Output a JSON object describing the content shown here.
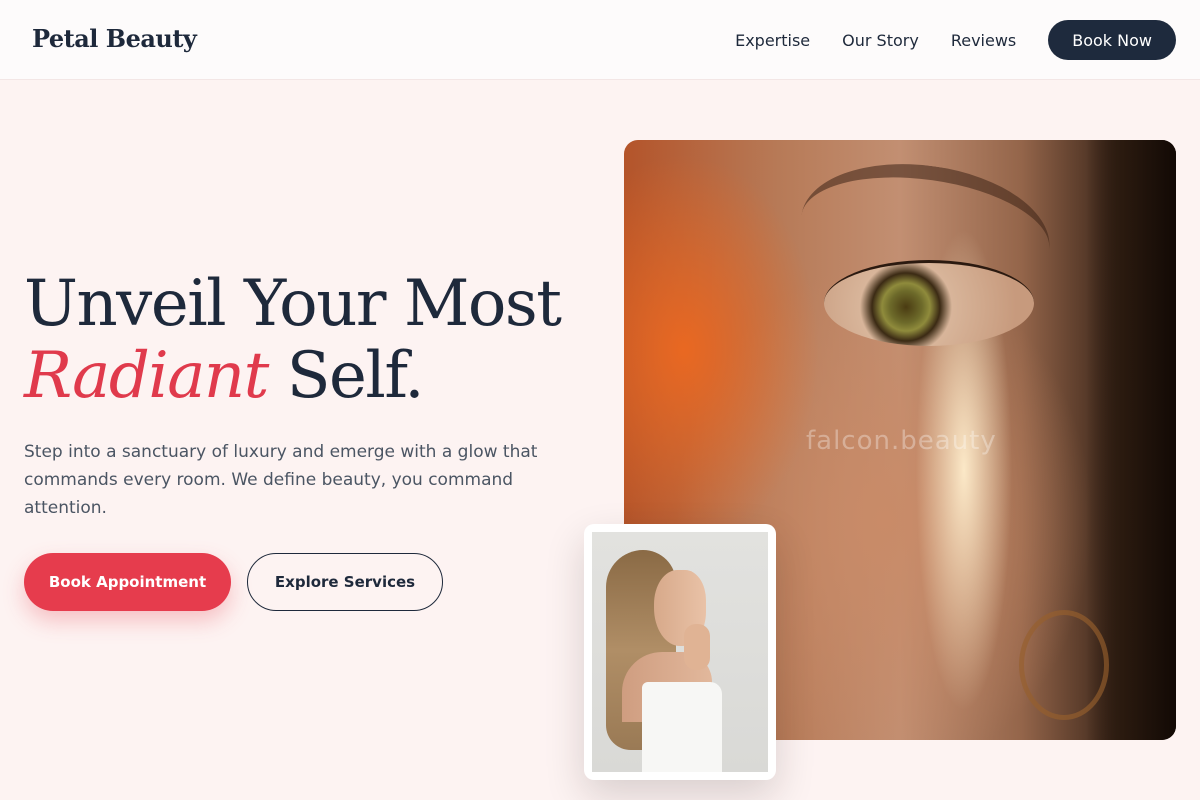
{
  "brand": {
    "name": "Petal Beauty"
  },
  "nav": {
    "links": [
      "Expertise",
      "Our Story",
      "Reviews"
    ],
    "cta": "Book Now"
  },
  "hero": {
    "headline_line1": "Unveil Your Most",
    "headline_accent": "Radiant",
    "headline_end": "Self.",
    "subtext": "Step into a sanctuary of luxury and emerge with a glow that commands every room. We define beauty, you command attention.",
    "primary_button": "Book Appointment",
    "secondary_button": "Explore Services"
  },
  "images": {
    "main_watermark": "falcon.beauty"
  },
  "colors": {
    "accent": "#e63c4d",
    "navy": "#1e2a3d",
    "background": "#fdf3f2"
  }
}
